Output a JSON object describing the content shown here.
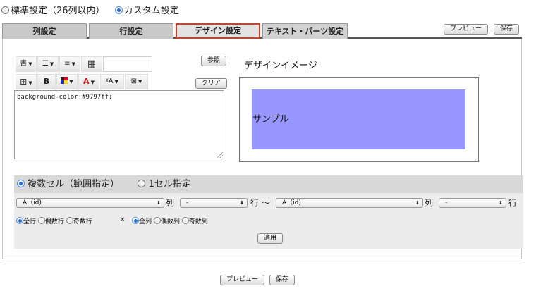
{
  "mode": {
    "options": [
      {
        "label": "標準設定（26列以内）",
        "selected": false
      },
      {
        "label": "カスタム設定",
        "selected": true
      }
    ]
  },
  "tabs": [
    {
      "label": "列設定",
      "active": false
    },
    {
      "label": "行設定",
      "active": false
    },
    {
      "label": "デザイン設定",
      "active": true
    },
    {
      "label": "テキスト・パーツ設定",
      "active": false
    }
  ],
  "top_buttons": {
    "preview": "プレビュー",
    "save": "保存"
  },
  "toolbar": {
    "row1": [
      {
        "icon": "text-style-icon",
        "glyph": "書"
      },
      {
        "icon": "align-center-icon",
        "glyph": "☰"
      },
      {
        "icon": "align-left-icon",
        "glyph": "≡"
      },
      {
        "icon": "table-grid-icon",
        "glyph": "▦"
      }
    ],
    "row2": [
      {
        "icon": "border-icon",
        "glyph": "⊞"
      },
      {
        "icon": "bold-icon",
        "glyph": "B"
      },
      {
        "icon": "background-color-icon",
        "glyph": "▩"
      },
      {
        "icon": "font-color-icon",
        "glyph": "A"
      },
      {
        "icon": "font-size-icon",
        "glyph": "ᵡA"
      },
      {
        "icon": "image-icon",
        "glyph": "⊠"
      }
    ],
    "browse_label": "参照",
    "clear_label": "クリア"
  },
  "editor": {
    "css_text": "background-color:#9797ff;"
  },
  "design_image": {
    "title": "デザインイメージ",
    "sample_text": "サンプル",
    "sample_color": "#9797ff"
  },
  "range": {
    "mode_options": [
      {
        "label": "複数セル（範囲指定）",
        "selected": true
      },
      {
        "label": "1セル指定",
        "selected": false
      }
    ],
    "from_col_value": "A（id)",
    "col_unit": "列",
    "from_row_value": "-",
    "row_unit": "行 〜",
    "to_col_value": "A（id)",
    "to_col_unit": "列",
    "to_row_value": "-",
    "to_row_unit": "行",
    "row_filters": [
      {
        "label": "全行",
        "selected": true
      },
      {
        "label": "偶数行",
        "selected": false
      },
      {
        "label": "奇数行",
        "selected": false
      }
    ],
    "times": "×",
    "col_filters": [
      {
        "label": "全列",
        "selected": true
      },
      {
        "label": "偶数列",
        "selected": false
      },
      {
        "label": "奇数列",
        "selected": false
      }
    ],
    "apply_label": "適用"
  },
  "bottom_buttons": {
    "preview": "プレビュー",
    "save": "保存"
  }
}
